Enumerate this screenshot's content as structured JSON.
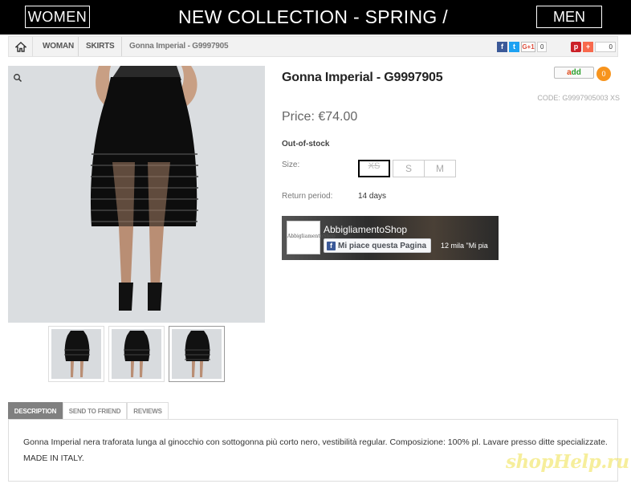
{
  "header": {
    "women_label": "WOMEN",
    "collection_title": "NEW COLLECTION - SPRING / SUMMER",
    "men_label": "MEN"
  },
  "breadcrumb": {
    "items": [
      "WOMAN",
      "SKIRTS"
    ],
    "current": "Gonna Imperial - G9997905"
  },
  "share": {
    "gplus_label": "G+1",
    "gplus_count": "0",
    "plus_label": "+",
    "pin_count": "0"
  },
  "product": {
    "title": "Gonna Imperial - G9997905",
    "code": "CODE: G9997905003 XS",
    "price": "Price: €74.00",
    "stock": "Out-of-stock",
    "size_label": "Size:",
    "sizes": [
      "XS",
      "S",
      "M"
    ],
    "selected_size": "XS",
    "return_label": "Return period:",
    "return_value": "14 days",
    "add_label_1": "a",
    "add_label_2": "dd",
    "add_count": "0"
  },
  "facebook": {
    "page_name": "AbbigliamentoShop",
    "like_label": "Mi piace questa Pagina",
    "like_count": "12 mila \"Mi pia",
    "logo_text": "AbbigliamentoShop"
  },
  "tabs": [
    {
      "label": "DESCRIPTION",
      "active": true
    },
    {
      "label": "SEND TO FRIEND",
      "active": false
    },
    {
      "label": "REVIEWS",
      "active": false
    }
  ],
  "description": "Gonna Imperial nera traforata lunga al ginocchio con sottogonna più corto nero, vestibilità regular. Composizione: 100% pl. Lavare presso ditte specializzate. MADE IN ITALY.",
  "watermark": "shopHelp.ru",
  "colors": {
    "header_bg": "#000000",
    "tab_active": "#808080",
    "add_badge": "#f7941d",
    "facebook_blue": "#3b5998"
  }
}
